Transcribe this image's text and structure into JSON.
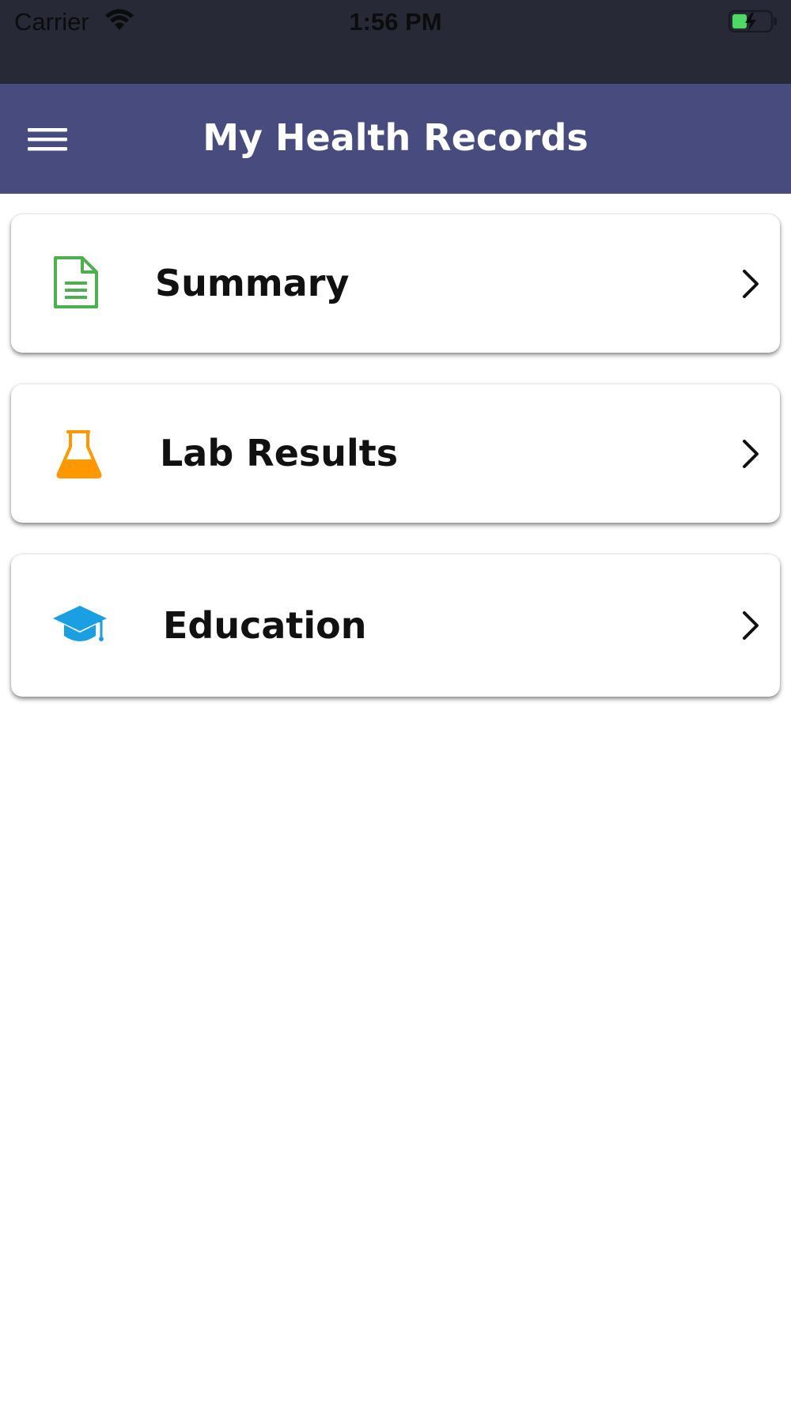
{
  "status_bar": {
    "carrier": "Carrier",
    "time": "1:56 PM",
    "battery_color": "#4cd964"
  },
  "header": {
    "title": "My Health Records",
    "background": "#474b7e"
  },
  "menu": {
    "items": [
      {
        "label": "Summary",
        "icon": "document-icon",
        "icon_color": "#4caf50"
      },
      {
        "label": "Lab Results",
        "icon": "flask-icon",
        "icon_color": "#ff9800"
      },
      {
        "label": "Education",
        "icon": "graduation-cap-icon",
        "icon_color": "#1a9fe3"
      }
    ]
  }
}
